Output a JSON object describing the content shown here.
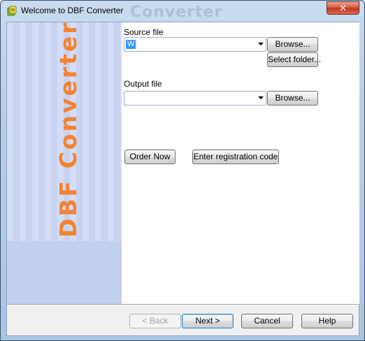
{
  "window": {
    "title": "Welcome to DBF Converter",
    "title_watermark": "Converter",
    "close_label": "✕"
  },
  "sidebar": {
    "brand": "DBF Converter"
  },
  "source": {
    "label": "Source file",
    "value": "W",
    "browse_label": "Browse...",
    "select_folder_label": "Select folder..."
  },
  "output": {
    "label": "Output file",
    "value": "",
    "browse_label": "Browse..."
  },
  "registration": {
    "order_label": "Order Now",
    "enter_code_label": "Enter registration code"
  },
  "footer": {
    "back_label": "< Back",
    "next_label": "Next >",
    "cancel_label": "Cancel",
    "help_label": "Help"
  },
  "colors": {
    "brand_orange": "#f5822f",
    "side_panel": "#c3cff0",
    "selection": "#3399ff"
  },
  "icons": {
    "app": "app-icon",
    "dropdown": "chevron-down-icon"
  }
}
